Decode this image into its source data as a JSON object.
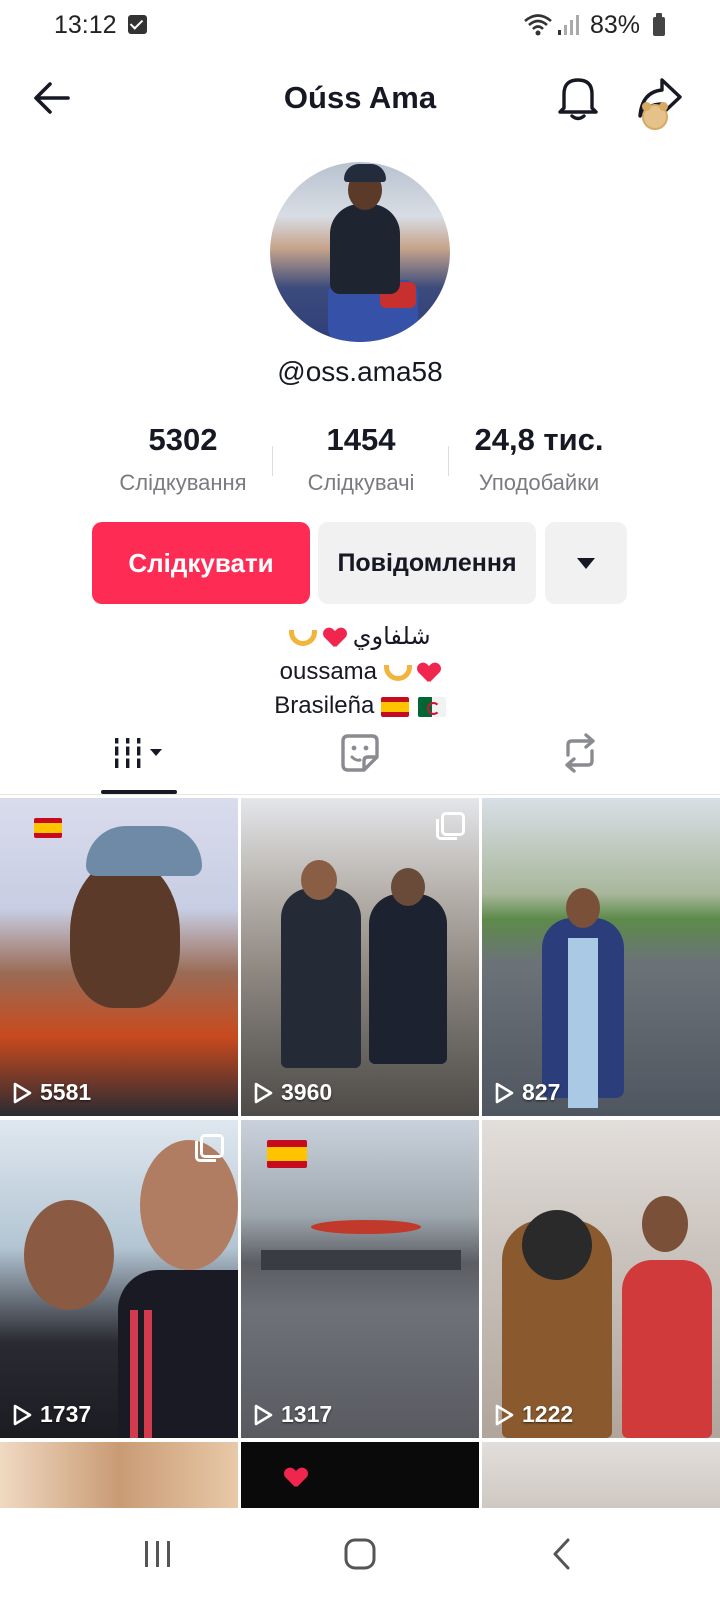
{
  "status_bar": {
    "time": "13:12",
    "battery": "83%"
  },
  "header": {
    "title": "Oúss Ama"
  },
  "profile": {
    "username": "@oss.ama58",
    "stats": [
      {
        "value": "5302",
        "label": "Слідкування"
      },
      {
        "value": "1454",
        "label": "Слідкувачі"
      },
      {
        "value": "24,8 тис.",
        "label": "Уподобайки"
      }
    ],
    "follow_label": "Слідкувати",
    "message_label": "Повідомлення",
    "bio": [
      "شلفاوي",
      "oussama",
      "Brasileña"
    ]
  },
  "tabs": [
    "videos-icon",
    "liked-sticker-icon",
    "reposts-icon"
  ],
  "videos": [
    {
      "views": "5581"
    },
    {
      "views": "3960"
    },
    {
      "views": "827"
    },
    {
      "views": "1737"
    },
    {
      "views": "1317"
    },
    {
      "views": "1222"
    }
  ],
  "colors": {
    "accent": "#fe2c55",
    "text": "#161823",
    "muted": "#7a7b82"
  }
}
